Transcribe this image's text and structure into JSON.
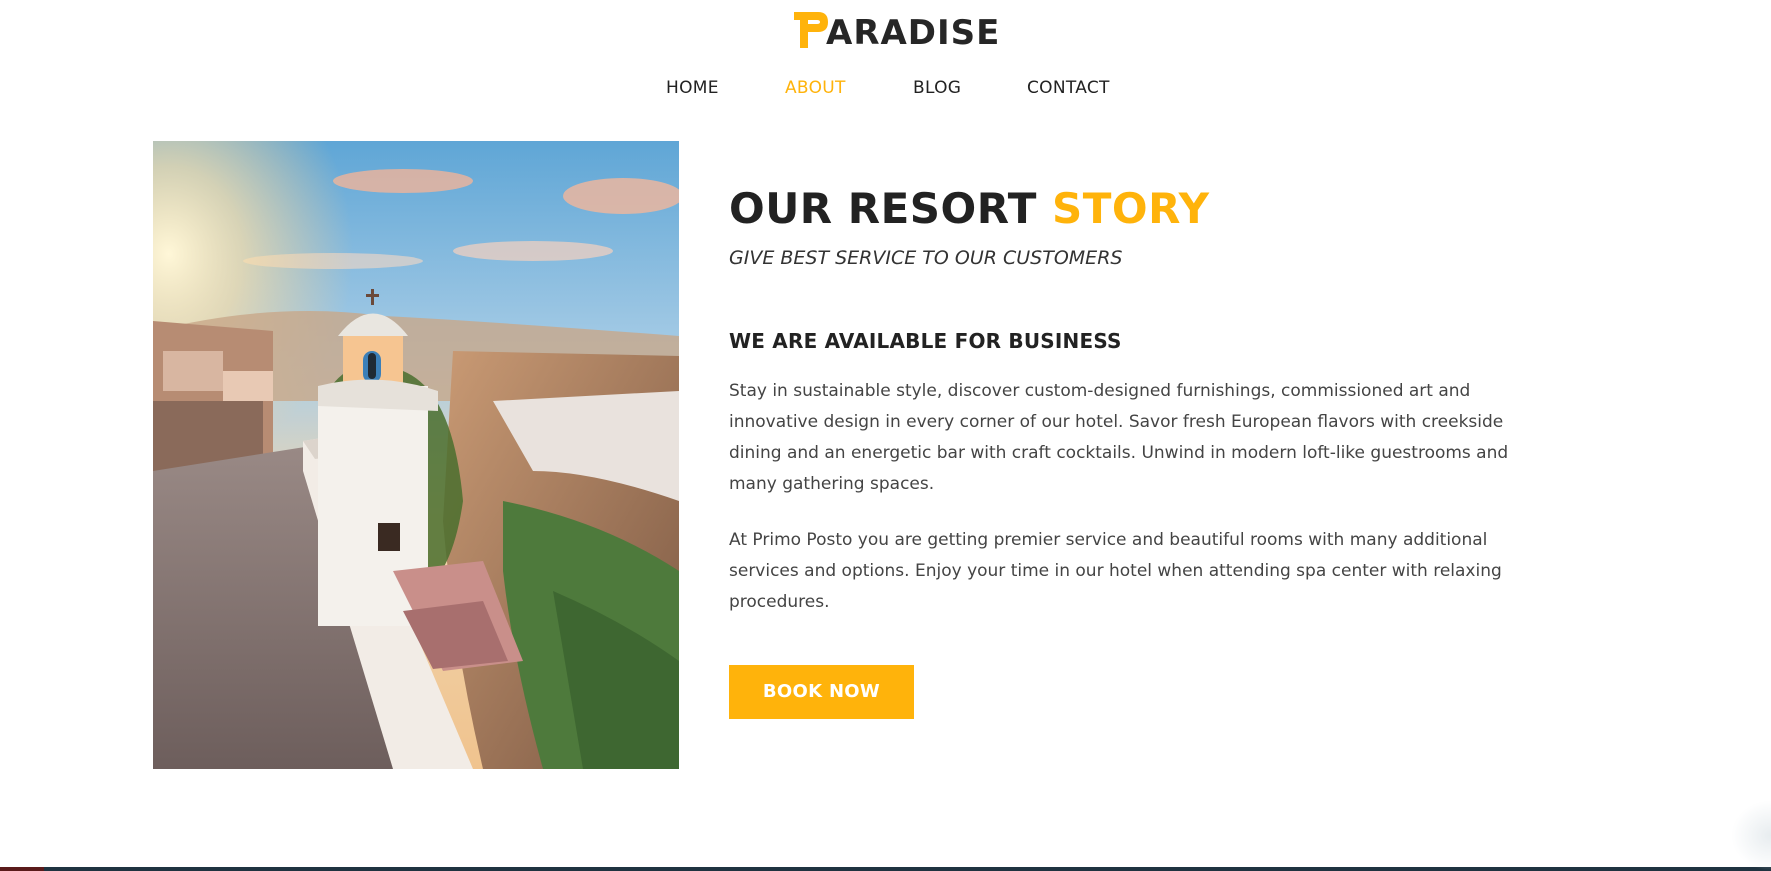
{
  "header": {
    "logo_text": "ARADISE",
    "logo_icon": "p-logo-icon"
  },
  "nav": {
    "items": [
      {
        "label": "HOME",
        "active": false
      },
      {
        "label": "ABOUT",
        "active": true
      },
      {
        "label": "BLOG",
        "active": false
      },
      {
        "label": "CONTACT",
        "active": false
      }
    ]
  },
  "colors": {
    "accent": "#ffb30b",
    "text_dark": "#222222",
    "text_body": "#444444"
  },
  "about": {
    "title_main": "OUR RESORT ",
    "title_accent": "STORY",
    "subtitle": "GIVE BEST SERVICE TO OUR CUSTOMERS",
    "heading": "WE ARE AVAILABLE FOR BUSINESS",
    "paragraph_1": "Stay in sustainable style, discover custom-designed furnishings, commissioned art and innovative design in every corner of our hotel. Savor fresh European flavors with creekside dining and an energetic bar with craft cocktails. Unwind in modern loft-like guestrooms and many gathering spaces.",
    "paragraph_2": "At Primo Posto you are getting premier service and beautiful rooms with many additional services and options. Enjoy your time in our hotel when attending spa center with relaxing procedures.",
    "button_label": "BOOK NOW",
    "image": "santorini-chapel-image"
  }
}
